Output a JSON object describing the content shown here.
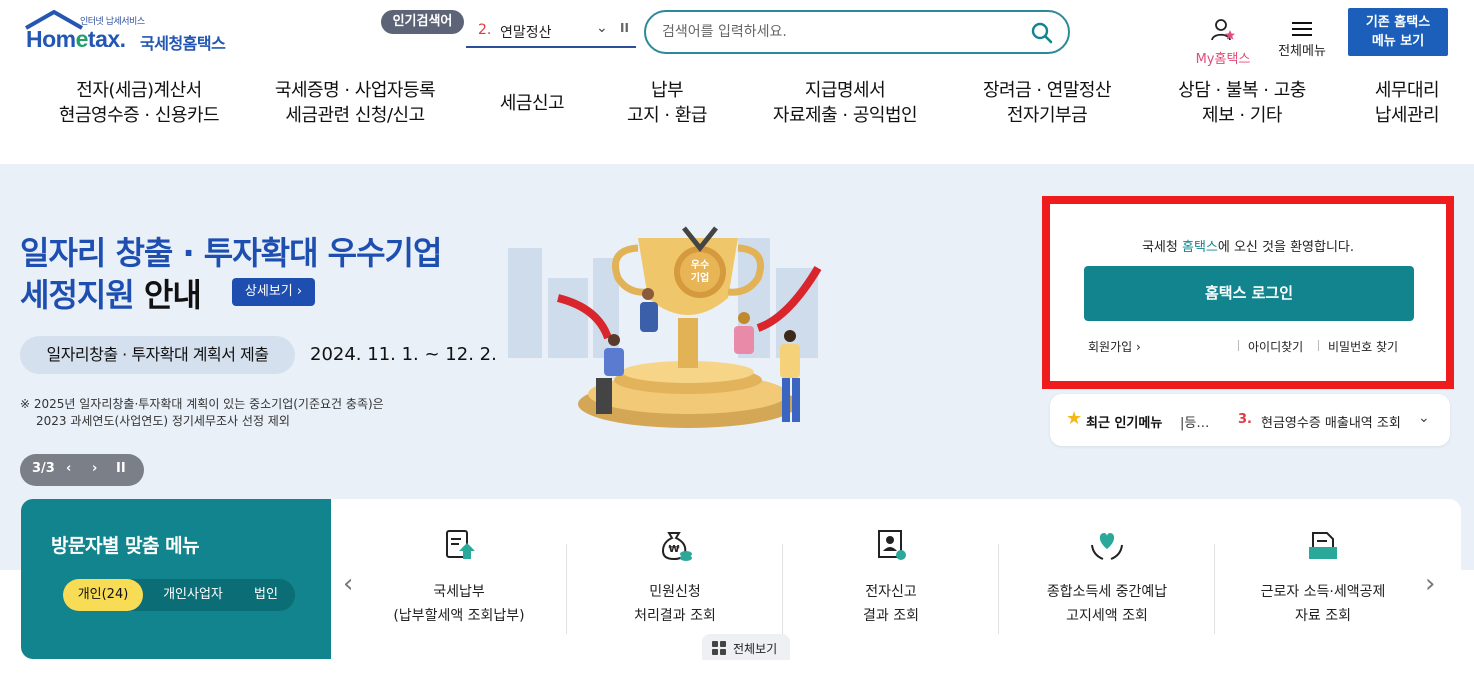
{
  "header": {
    "logo_tiny": "인터넷 납세서비스",
    "logo_brand_a": "Hom",
    "logo_brand_e": "e",
    "logo_brand_b": "tax.",
    "logo_kr": "국세청홈택스",
    "popular_label": "인기검색어",
    "popular_rank": "2.",
    "popular_term": "연말정산",
    "search_placeholder": "검색어를 입력하세요.",
    "my_hometax": "My홈택스",
    "all_menu": "전체메뉴",
    "old_hometax_line1": "기존 홈택스",
    "old_hometax_line2": "메뉴 보기"
  },
  "gnb": [
    {
      "l1": "전자(세금)계산서",
      "l2": "현금영수증 · 신용카드"
    },
    {
      "l1": "국세증명 · 사업자등록",
      "l2": "세금관련 신청/신고"
    },
    {
      "l1": "세금신고",
      "l2": ""
    },
    {
      "l1": "납부",
      "l2": "고지 · 환급"
    },
    {
      "l1": "지급명세서",
      "l2": "자료제출 · 공익법인"
    },
    {
      "l1": "장려금 · 연말정산",
      "l2": "전자기부금"
    },
    {
      "l1": "상담 · 불복 · 고충",
      "l2": "제보 · 기타"
    },
    {
      "l1": "세무대리",
      "l2": "납세관리"
    }
  ],
  "hero": {
    "title_line1": "일자리 창출 · 투자확대 우수기업",
    "title_line2_a": "세정지원",
    "title_line2_b": " 안내",
    "detail_button": "상세보기",
    "pill": "일자리창출 · 투자확대 계획서 제출",
    "date": "2024. 11. 1. ~ 12. 2.",
    "note_line1": "※ 2025년 일자리창출·투자확대 계획이 있는 중소기업(기준요건 충족)은",
    "note_line2": "2023 과세연도(사업연도) 정기세무조사 선정 제외",
    "pager": "3/3",
    "medal_text": "우수기업"
  },
  "login": {
    "welcome_a": "국세청 ",
    "welcome_hl": "홈택스",
    "welcome_b": "에 오신 것을 환영합니다.",
    "login_button": "홈택스 로그인",
    "join": "회원가입",
    "find_id": "아이디찾기",
    "find_pw": "비밀번호 찾기"
  },
  "recent": {
    "title": "최근 인기메뉴",
    "prev_item": "|등…",
    "rank": "3.",
    "item": "현금영수증 매출내역 조회"
  },
  "visitor": {
    "title": "방문자별 맞춤 메뉴",
    "tabs": [
      "개인(24)",
      "개인사업자",
      "법인"
    ],
    "active_tab": 0
  },
  "quick": [
    {
      "l1": "국세납부",
      "l2": "(납부할세액 조회납부)",
      "icon": "tax-document-upload-icon"
    },
    {
      "l1": "민원신청",
      "l2": "처리결과 조회",
      "icon": "money-bag-coins-icon"
    },
    {
      "l1": "전자신고",
      "l2": "결과 조회",
      "icon": "certificate-person-icon"
    },
    {
      "l1": "종합소득세 중간예납",
      "l2": "고지세액 조회",
      "icon": "heart-hands-icon"
    },
    {
      "l1": "근로자 소득·세액공제",
      "l2": "자료 조회",
      "icon": "folder-document-icon"
    }
  ],
  "view_all": "전체보기",
  "colors": {
    "brand_blue": "#1e4fb0",
    "teal": "#12848d",
    "highlight_red": "#ee1c1c",
    "active_tab_yellow": "#f8dc55"
  }
}
